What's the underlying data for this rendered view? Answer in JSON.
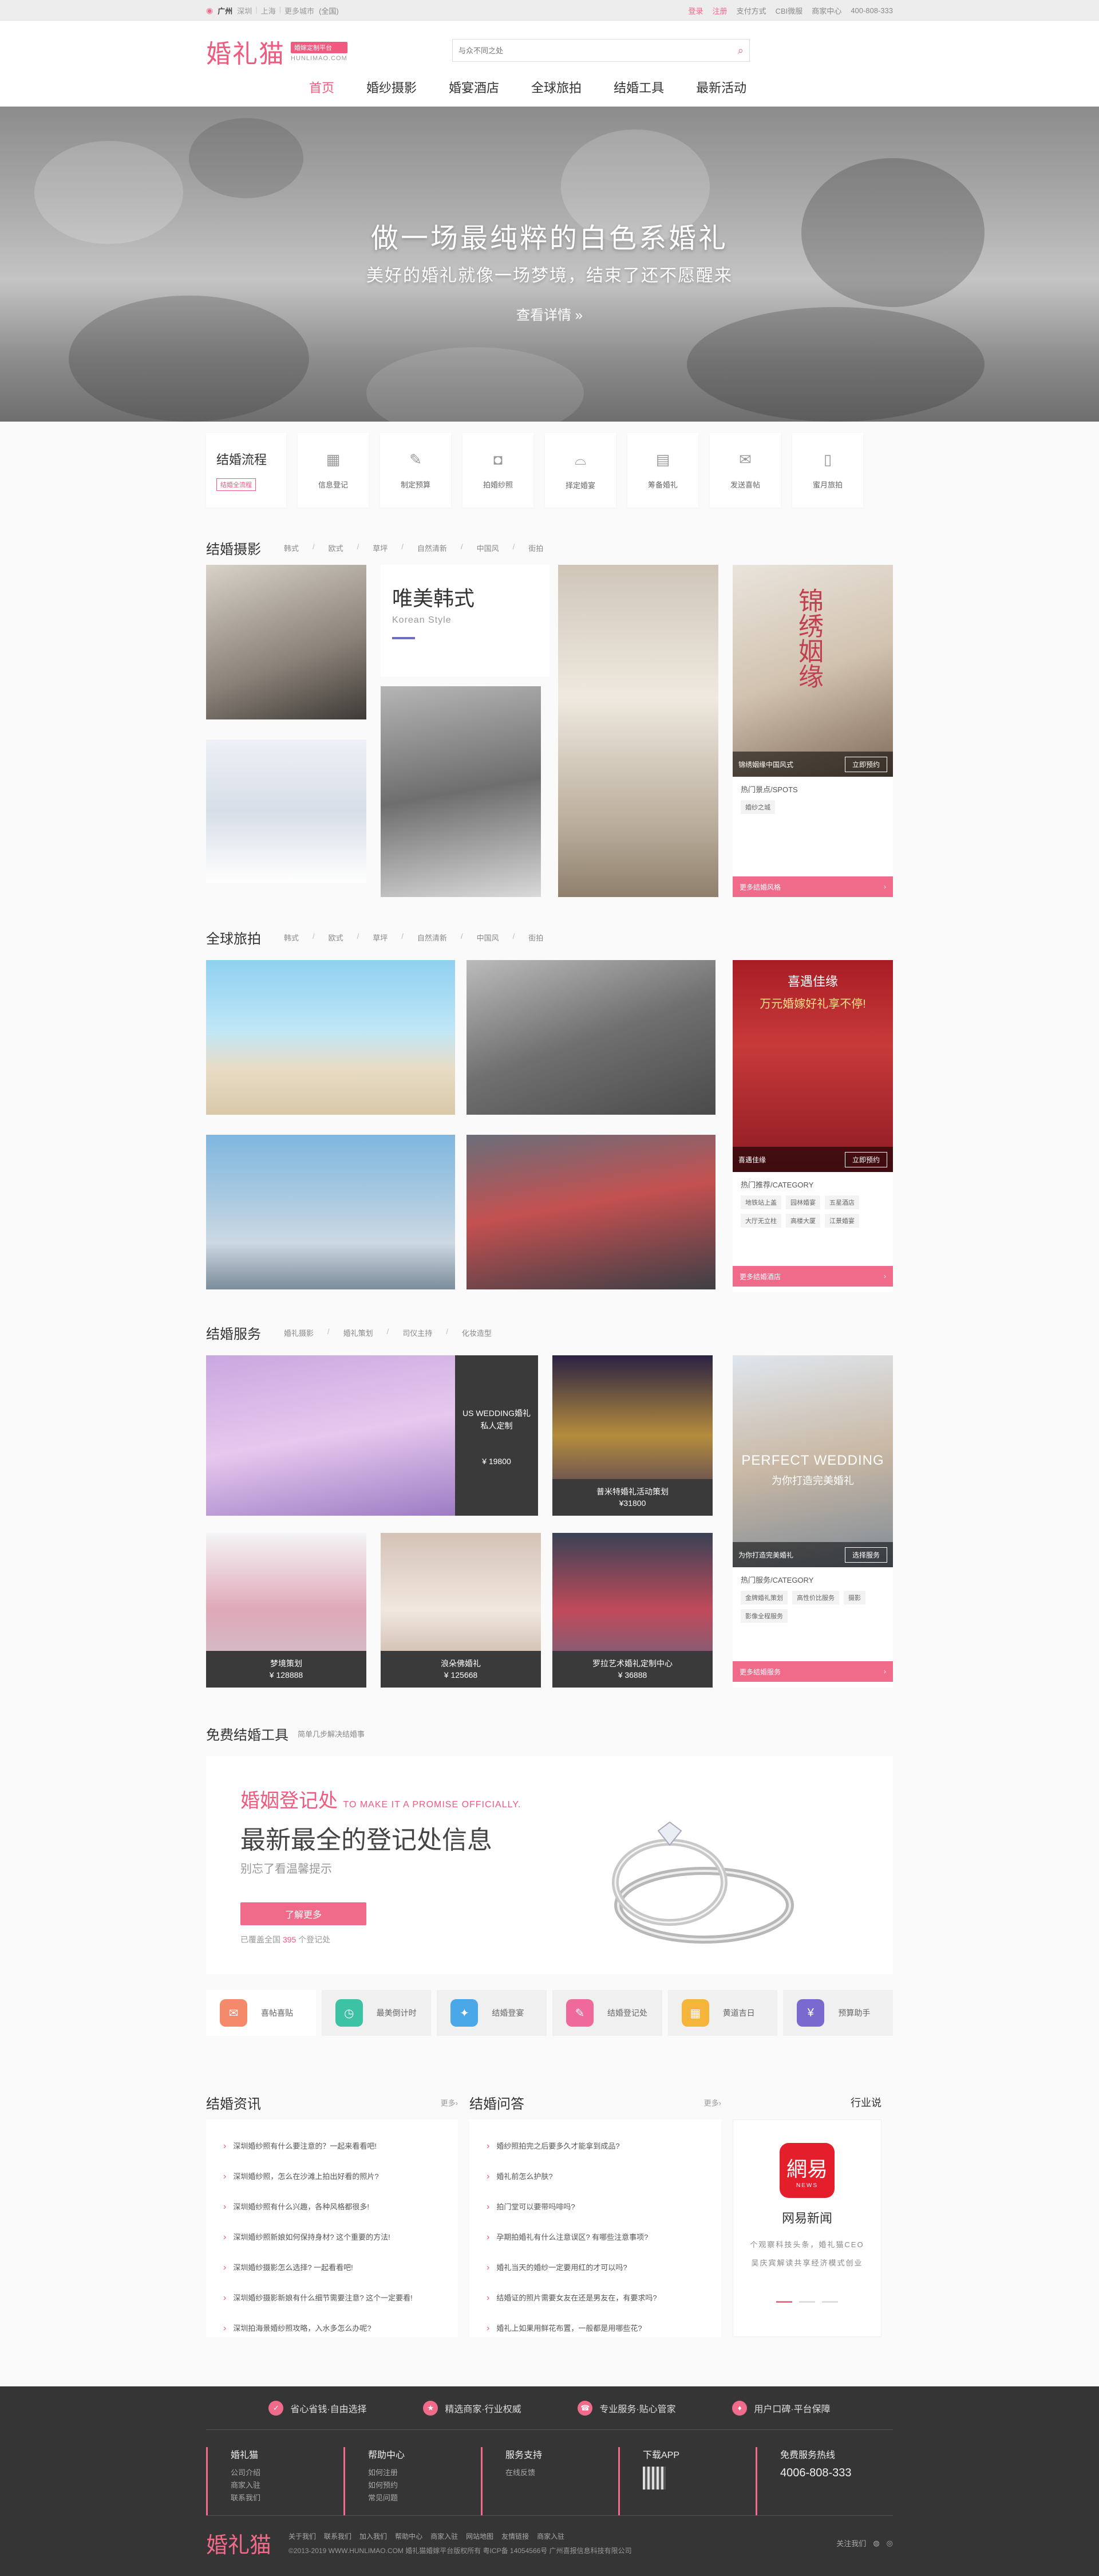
{
  "topbar": {
    "city": "广州",
    "cities": [
      "深圳",
      "上海",
      "更多城市"
    ],
    "city_note": "(全国)",
    "links": [
      "登录",
      "注册",
      "支付方式",
      "CBI微服",
      "商家中心"
    ],
    "phone": "400-808-333"
  },
  "header": {
    "logo": "婚礼猫",
    "tagline": "婚嫁定制平台",
    "domain": "HUNLIMAO.COM",
    "search_placeholder": "与众不同之处",
    "nav": [
      "首页",
      "婚纱摄影",
      "婚宴酒店",
      "全球旅拍",
      "结婚工具",
      "最新活动"
    ]
  },
  "hero": {
    "title": "做一场最纯粹的白色系婚礼",
    "subtitle": "美好的婚礼就像一场梦境，结束了还不愿醒来",
    "cta": "查看详情 »"
  },
  "process": {
    "title": "结婚流程",
    "badge": "结婚全流程",
    "steps": [
      "信息登记",
      "制定预算",
      "拍婚纱照",
      "择定婚宴",
      "筹备婚礼",
      "发送喜帖",
      "蜜月旅拍"
    ]
  },
  "photography": {
    "title": "结婚摄影",
    "tabs": [
      "韩式",
      "欧式",
      "草坪",
      "自然清新",
      "中国风",
      "街拍"
    ],
    "feature_title": "唯美韩式",
    "feature_en": "Korean Style",
    "promo_caption": "锦绣姻缘",
    "promo_text": "锦绣姻缘中国风式",
    "promo_button": "立即预约",
    "spots_title": "热门景点/SPOTS",
    "spots": [
      "婚纱之城"
    ],
    "more": "更多结婚风格"
  },
  "travel": {
    "title": "全球旅拍",
    "tabs": [
      "韩式",
      "欧式",
      "草坪",
      "自然清新",
      "中国风",
      "街拍"
    ],
    "promo_title": "万元婚嫁好礼享不停!",
    "promo_sub": "喜遇佳缘",
    "promo_button": "立即预约",
    "cat_title": "热门推荐/CATEGORY",
    "cats": [
      "地铁站上盖",
      "园林婚宴",
      "五星酒店",
      "大厅无立柱",
      "高楼大厦",
      "江景婚宴"
    ],
    "more": "更多结婚酒店"
  },
  "service": {
    "title": "结婚服务",
    "tabs": [
      "婚礼摄影",
      "婚礼策划",
      "司仪主持",
      "化妆造型"
    ],
    "cards": [
      {
        "name": "US WEDDING婚礼私人定制",
        "price": "¥ 19800"
      },
      {
        "name": "普米特婚礼活动策划",
        "price": "¥31800"
      },
      {
        "name": "梦境策划",
        "price": "¥ 128888"
      },
      {
        "name": "浪朵佛婚礼",
        "price": "¥ 125668"
      },
      {
        "name": "罗拉艺术婚礼定制中心",
        "price": "¥ 36888"
      }
    ],
    "promo_title": "PERFECT WEDDING",
    "promo_sub": "为你打造完美婚礼",
    "promo_button": "选择服务",
    "cat_title": "热门服务/CATEGORY",
    "cats": [
      "金牌婚礼策划",
      "高性价比服务",
      "摄影",
      "影像全程服务"
    ],
    "more": "更多结婚服务"
  },
  "tools": {
    "title": "免费结婚工具",
    "subtitle": "简单几步解决结婚事",
    "banner_title": "婚姻登记处",
    "banner_en": "TO MAKE IT A PROMISE OFFICIALLY.",
    "banner_main": "最新最全的登记处信息",
    "banner_sub": "别忘了看温馨提示",
    "banner_btn": "了解更多",
    "banner_count_pre": "已覆盖全国",
    "banner_count": "395",
    "banner_count_post": "个登记处",
    "items": [
      "喜帖喜贴",
      "最美倒计时",
      "结婚登宴",
      "结婚登记处",
      "黄道吉日",
      "预算助手"
    ]
  },
  "news": {
    "col1_title": "结婚资讯",
    "col1_more": "更多›",
    "col1_items": [
      "深圳婚纱照有什么要注意的？一起来看看吧!",
      "深圳婚纱照，怎么在沙滩上拍出好看的照片?",
      "深圳婚纱照有什么兴趣，各种风格都很多!",
      "深圳婚纱照新娘如何保持身材? 这个重要的方法!",
      "深圳婚纱摄影怎么选择? 一起看看吧!",
      "深圳婚纱摄影新娘有什么细节需要注意? 这个一定要看!",
      "深圳拍海景婚纱照攻略，入水多怎么办呢?"
    ],
    "col2_title": "结婚问答",
    "col2_more": "更多›",
    "col2_items": [
      "婚纱照拍完之后要多久才能拿到成品?",
      "婚礼前怎么护肤?",
      "拍门堂可以要带吗啡吗?",
      "孕期拍婚礼有什么注意误区? 有哪些注意事项?",
      "婚礼当天的婚纱一定要用红的才可以吗?",
      "结婚证的照片需要女友在还是男友在，有要求吗?",
      "婚礼上如果用鲜花布置，一般都是用哪些花?"
    ],
    "industry_title": "行业说",
    "industry_name": "网易新闻",
    "industry_logo": "網易",
    "industry_logo_sub": "NEWS",
    "industry_desc": "个观察科技头条，婚礼猫CEO吴庆宾解读共享经济模式创业"
  },
  "footer": {
    "pledges": [
      "省心省钱·自由选择",
      "精选商家·行业权威",
      "专业服务·贴心管家",
      "用户口碑·平台保障"
    ],
    "cols": [
      {
        "h": "婚礼猫",
        "l": [
          "公司介绍",
          "商家入驻",
          "联系我们"
        ]
      },
      {
        "h": "帮助中心",
        "l": [
          "如何注册",
          "如何预约",
          "常见问题"
        ]
      },
      {
        "h": "服务支持",
        "l": [
          "在线反馈"
        ]
      },
      {
        "h": "下载APP",
        "l": []
      }
    ],
    "hotline_label": "免费服务热线",
    "hotline": "4006-808-333",
    "logo": "婚礼猫",
    "links": [
      "关于我们",
      "联系我们",
      "加入我们",
      "帮助中心",
      "商家入驻",
      "网站地图",
      "友情链接",
      "商家入驻"
    ],
    "copyright": "©2013-2019 WWW.HUNLIMAO.COM 婚礼猫婚嫁平台版权所有 粤ICP备 14054566号 广州喜报信息科技有限公司",
    "follow": "关注我们"
  },
  "colors": {
    "brand": "#f05a7e",
    "footer": "#353535"
  }
}
